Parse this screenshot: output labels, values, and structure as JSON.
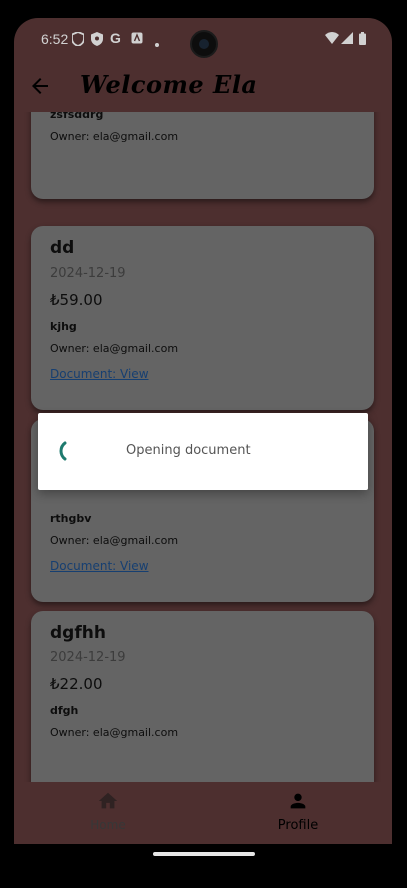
{
  "status": {
    "time": "6:52",
    "icons": [
      "shield-icon",
      "privacy-icon",
      "google-icon",
      "app-icon",
      "dot-icon",
      "wifi-icon",
      "signal-icon",
      "battery-icon"
    ]
  },
  "appbar": {
    "back_icon": "arrow-back-icon",
    "title": "Welcome Ela"
  },
  "cards": [
    {
      "description": "zsfsddrg",
      "owner": "Owner: ela@gmail.com"
    },
    {
      "title": "dd",
      "date": "2024-12-19",
      "price": "₺59.00",
      "description": "kjhg",
      "owner": "Owner: ela@gmail.com",
      "document_link": "Document: View"
    },
    {
      "description": "rthgbv",
      "owner": "Owner: ela@gmail.com",
      "document_link": "Document: View"
    },
    {
      "title": "dgfhh",
      "date": "2024-12-19",
      "price": "₺22.00",
      "description": "dfgh",
      "owner": "Owner: ela@gmail.com"
    }
  ],
  "dialog": {
    "message": "Opening document"
  },
  "bottom_nav": {
    "home_label": "Home",
    "profile_label": "Profile"
  },
  "colors": {
    "background": "#5e3a3a",
    "card": "#7a7a7a",
    "spinner": "#1e7a6e",
    "link": "#1c4d8a"
  }
}
